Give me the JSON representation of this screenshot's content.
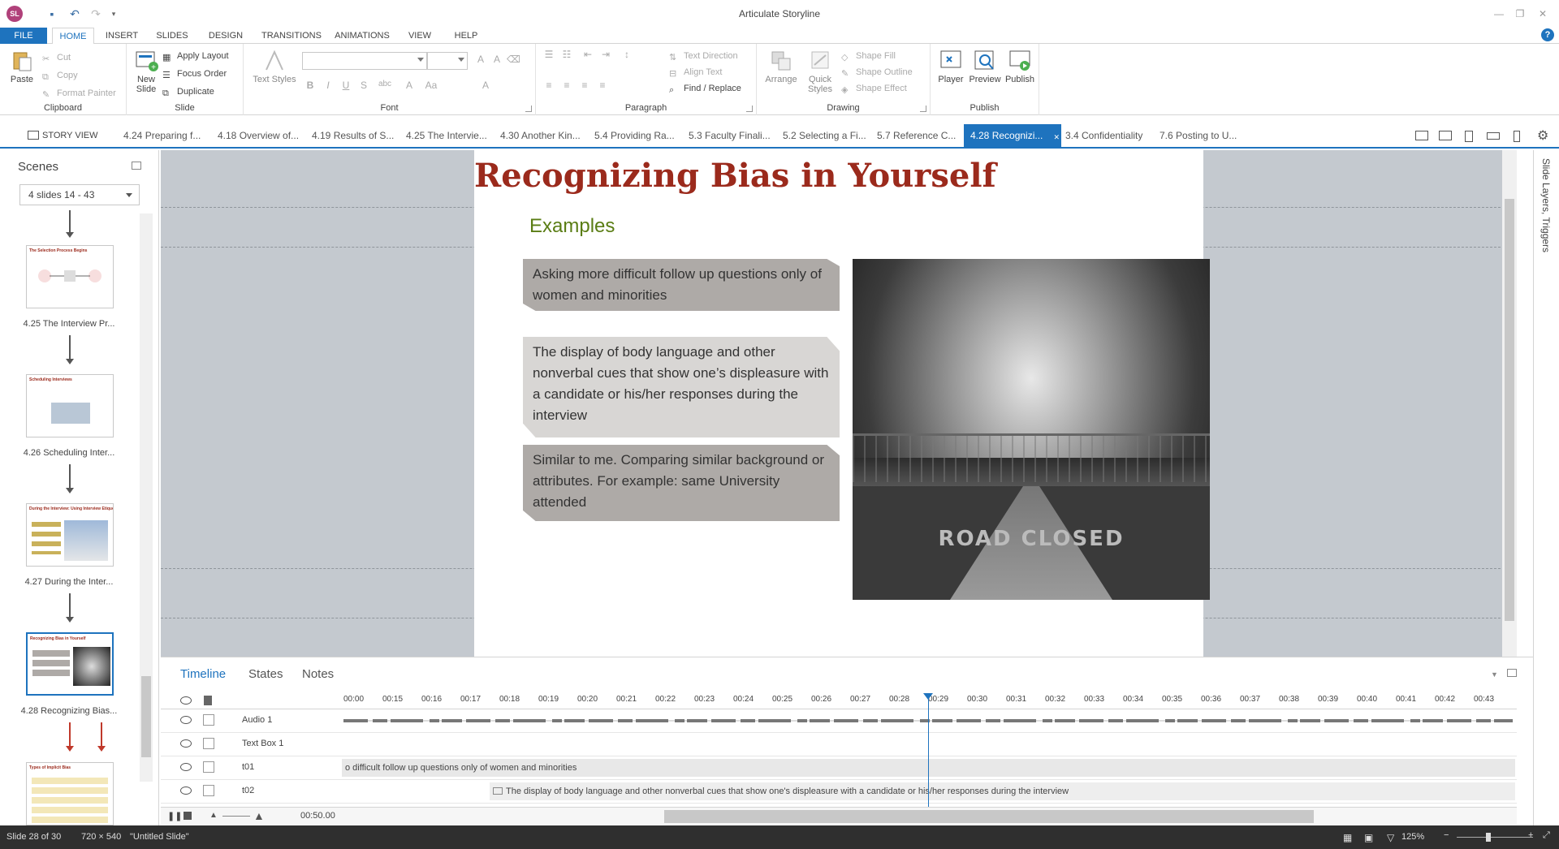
{
  "app": {
    "title": "Articulate Storyline",
    "icon_text": "SL",
    "qat_icons": [
      "save-icon",
      "undo-icon",
      "redo-icon",
      "customize-qat-icon"
    ]
  },
  "ribbon": {
    "tabs": [
      "FILE",
      "HOME",
      "INSERT",
      "SLIDES",
      "DESIGN",
      "TRANSITIONS",
      "ANIMATIONS",
      "VIEW",
      "HELP"
    ],
    "active_tab": "HOME",
    "clipboard": {
      "paste": "Paste",
      "cut": "Cut",
      "copy": "Copy",
      "format_painter": "Format Painter",
      "label": "Clipboard"
    },
    "slide": {
      "new_slide": "New Slide",
      "apply_layout": "Apply Layout",
      "focus_order": "Focus Order",
      "duplicate": "Duplicate",
      "label": "Slide"
    },
    "font": {
      "text_styles": "Text Styles",
      "label": "Font",
      "format_buttons": [
        "B",
        "I",
        "U",
        "S",
        "abc",
        "A",
        "Aa",
        "A"
      ]
    },
    "paragraph": {
      "text_direction": "Text Direction",
      "align_text": "Align Text",
      "find_replace": "Find / Replace",
      "label": "Paragraph"
    },
    "drawing": {
      "arrange": "Arrange",
      "quick_styles": "Quick Styles",
      "shape_fill": "Shape Fill",
      "shape_outline": "Shape Outline",
      "shape_effect": "Shape Effect",
      "label": "Drawing"
    },
    "publish": {
      "player": "Player",
      "preview": "Preview",
      "publish": "Publish",
      "label": "Publish"
    }
  },
  "slide_tabs": {
    "story_view": "STORY VIEW",
    "tabs": [
      "4.24 Preparing f...",
      "4.18 Overview of...",
      "4.19 Results of S...",
      "4.25 The Intervie...",
      "4.30 Another Kin...",
      "5.4 Providing Ra...",
      "5.3 Faculty Finali...",
      "5.2 Selecting a Fi...",
      "5.7 Reference C...",
      "4.28 Recognizi...",
      "3.4 Confidentiality",
      "7.6 Posting to U..."
    ],
    "active_index": 9
  },
  "scenes": {
    "title": "Scenes",
    "dropdown": "4 slides 14 - 43",
    "thumbnails": [
      {
        "label": "4.25 The Interview Pr...",
        "title": "The Selection Process Begins"
      },
      {
        "label": "4.26 Scheduling Inter...",
        "title": "Scheduling Interviews"
      },
      {
        "label": "4.27 During the Inter...",
        "title": "During the Interview: Using Interview Etiquette"
      },
      {
        "label": "4.28 Recognizing Bias...",
        "title": "Recognizing Bias in Yourself"
      },
      {
        "label": "",
        "title": "Types of Implicit Bias"
      }
    ]
  },
  "slide": {
    "title": "Recognizing Bias in Yourself",
    "subtitle": "Examples",
    "callouts": [
      "Asking more difficult follow up questions only of women and minorities",
      "The display of body language and other nonverbal cues that show one’s displeasure with a candidate or his/her responses during the interview",
      "Similar to me. Comparing similar background or attributes. For example: same University attended"
    ],
    "image_text": "ROAD CLOSED"
  },
  "side_panel": {
    "label": "Slide Layers, Triggers"
  },
  "timeline": {
    "tabs": [
      "Timeline",
      "States",
      "Notes"
    ],
    "active_tab": "Timeline",
    "ticks": [
      "00:00",
      "00:15",
      "00:16",
      "00:17",
      "00:18",
      "00:19",
      "00:20",
      "00:21",
      "00:22",
      "00:23",
      "00:24",
      "00:25",
      "00:26",
      "00:27",
      "00:28",
      "00:29",
      "00:30",
      "00:31",
      "00:32",
      "00:33",
      "00:34",
      "00:35",
      "00:36",
      "00:37",
      "00:38",
      "00:39",
      "00:40",
      "00:41",
      "00:42",
      "00:43"
    ],
    "rows": [
      {
        "name": "Audio 1",
        "text": ""
      },
      {
        "name": "Text Box 1",
        "text": ""
      },
      {
        "name": "t01",
        "text": "o difficult follow up questions only of women and minorities"
      },
      {
        "name": "t02",
        "text": "The display of body language and other nonverbal cues that show one's displeasure with a candidate or his/her responses during the interview"
      }
    ],
    "total_time": "00:50.00",
    "playhead_time": "00:29"
  },
  "status": {
    "slide_count": "Slide 28 of 30",
    "dimensions": "720 × 540",
    "theme": "\"Untitled Slide\"",
    "zoom": "125%"
  },
  "colors": {
    "accent": "#1e73be",
    "title_red": "#9b2a1c",
    "subtitle_green": "#5a7d14",
    "callout_dark": "#aeaaa7",
    "callout_light": "#d8d6d4"
  }
}
